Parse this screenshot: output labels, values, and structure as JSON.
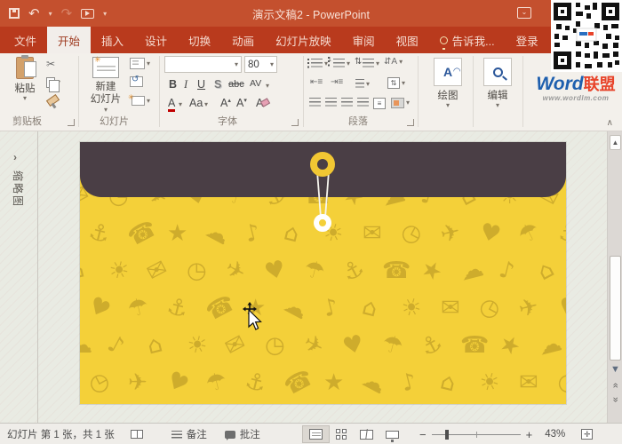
{
  "window": {
    "title": "演示文稿2 - PowerPoint"
  },
  "tabs": [
    {
      "label": "文件"
    },
    {
      "label": "开始",
      "active": true
    },
    {
      "label": "插入"
    },
    {
      "label": "设计"
    },
    {
      "label": "切换"
    },
    {
      "label": "动画"
    },
    {
      "label": "幻灯片放映"
    },
    {
      "label": "审阅"
    },
    {
      "label": "视图"
    },
    {
      "label": "告诉我...",
      "icon": "lightbulb-icon"
    },
    {
      "label": "登录"
    }
  ],
  "ribbon": {
    "clipboard": {
      "group_label": "剪贴板",
      "paste_label": "粘贴"
    },
    "slides": {
      "group_label": "幻灯片",
      "new_slide_line1": "新建",
      "new_slide_line2": "幻灯片"
    },
    "font": {
      "group_label": "字体",
      "font_size": "80",
      "bold": "B",
      "italic": "I",
      "underline": "U",
      "shadow": "S",
      "strikethrough": "abc",
      "char_spacing": "AV",
      "font_color": "A",
      "change_case": "Aa",
      "grow_font": "A",
      "shrink_font": "A",
      "clear_format": "A"
    },
    "paragraph": {
      "group_label": "段落",
      "text_direction": "⇵A"
    },
    "drawing": {
      "button_label": "绘图"
    },
    "editing": {
      "button_label": "编辑"
    }
  },
  "thumbnail_panel": {
    "label": "缩略图"
  },
  "statusbar": {
    "slide_counter": "幻灯片 第 1 张，共 1 张",
    "notes_label": "备注",
    "comments_label": "批注",
    "zoom_out": "−",
    "zoom_in": "+",
    "zoom_level": "43%",
    "fit_glyph": "✛"
  },
  "watermark": {
    "brand_primary": "Word",
    "brand_secondary": "联盟",
    "url": "www.wordlm.com"
  },
  "icons": {
    "undo": "↶",
    "redo": "↷",
    "dropdown": "▾",
    "chevron-right": "›",
    "collapse-ribbon": "∧",
    "scissors": "✂",
    "scroll-up": "▲",
    "scroll-down": "▼",
    "double-chevron": "«",
    "double-chevron-next": "»",
    "ribbon-display": "⌄"
  },
  "slide": {
    "pattern_glyphs": [
      "✉",
      "◷",
      "✈",
      "♥",
      "☂",
      "⚓",
      "☎",
      "★",
      "☁",
      "♪",
      "⌂",
      "☀"
    ]
  },
  "colors": {
    "titlebar": "#c4502e",
    "tabbar": "#b93a1d",
    "accent_red": "#b7472a",
    "ribbon_bg": "#f3f0eb",
    "workspace": "#e9ebe3",
    "slide_yellow": "#f4d039",
    "flap_dark": "#4a3e45",
    "clasp_yellow": "#f2c733",
    "brand_blue": "#1e5fae",
    "brand_orange": "#e8432a"
  }
}
